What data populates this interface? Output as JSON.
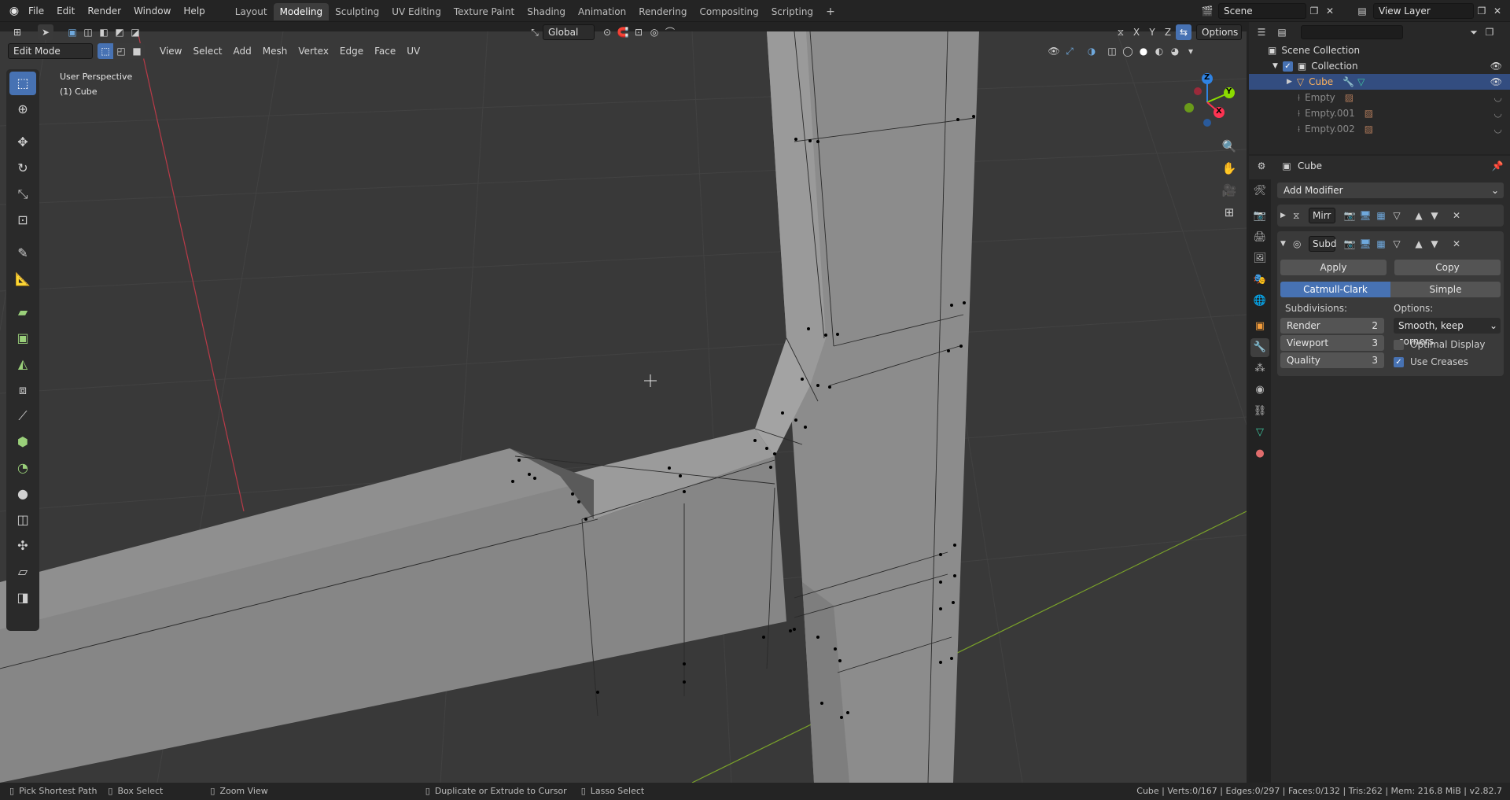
{
  "menu": {
    "items": [
      "File",
      "Edit",
      "Render",
      "Window",
      "Help"
    ],
    "workspaces": [
      "Layout",
      "Modeling",
      "Sculpting",
      "UV Editing",
      "Texture Paint",
      "Shading",
      "Animation",
      "Rendering",
      "Compositing",
      "Scripting"
    ],
    "active_workspace": "Modeling",
    "add_tab": "+",
    "scene_label": "Scene",
    "view_layer_label": "View Layer"
  },
  "viewport_header": {
    "mode": "Edit Mode",
    "menus": [
      "View",
      "Select",
      "Add",
      "Mesh",
      "Vertex",
      "Edge",
      "Face",
      "UV"
    ],
    "orientation": "Global",
    "axes": [
      "X",
      "Y",
      "Z"
    ],
    "options_label": "Options"
  },
  "viewport": {
    "perspective_label": "User Perspective",
    "object_label": "(1) Cube",
    "gizmo": {
      "x": "X",
      "y": "Y",
      "z": "Z"
    }
  },
  "outliner": {
    "search_placeholder": "",
    "root": "Scene Collection",
    "collection": "Collection",
    "items": [
      {
        "name": "Cube",
        "selected": true
      },
      {
        "name": "Empty",
        "selected": false
      },
      {
        "name": "Empty.001",
        "selected": false
      },
      {
        "name": "Empty.002",
        "selected": false
      }
    ]
  },
  "properties": {
    "object_name": "Cube",
    "add_modifier": "Add Modifier",
    "modifiers": [
      {
        "name": "Mirr",
        "expanded": false
      },
      {
        "name": "Subd",
        "expanded": true
      }
    ],
    "apply_label": "Apply",
    "copy_label": "Copy",
    "catmull_label": "Catmull-Clark",
    "simple_label": "Simple",
    "subdivisions_label": "Subdivisions:",
    "options_label": "Options:",
    "render_label": "Render",
    "render_value": "2",
    "viewport_label": "Viewport",
    "viewport_value": "3",
    "quality_label": "Quality",
    "quality_value": "3",
    "uv_smooth": "Smooth, keep corners",
    "optimal_display_label": "Optimal Display",
    "optimal_display": false,
    "use_creases_label": "Use Creases",
    "use_creases": true
  },
  "statusbar": {
    "left": [
      "Pick Shortest Path",
      "Box Select",
      "Zoom View",
      "Duplicate or Extrude to Cursor",
      "Lasso Select"
    ],
    "right": "Cube | Verts:0/167 | Edges:0/297 | Faces:0/132 | Tris:262 | Mem: 216.8 MiB | v2.82.7"
  },
  "colors": {
    "accent": "#4772b3",
    "x_axis": "#ff3352",
    "y_axis": "#8bdc00",
    "z_axis": "#2f83e3",
    "selected_text": "#ffb35c"
  }
}
